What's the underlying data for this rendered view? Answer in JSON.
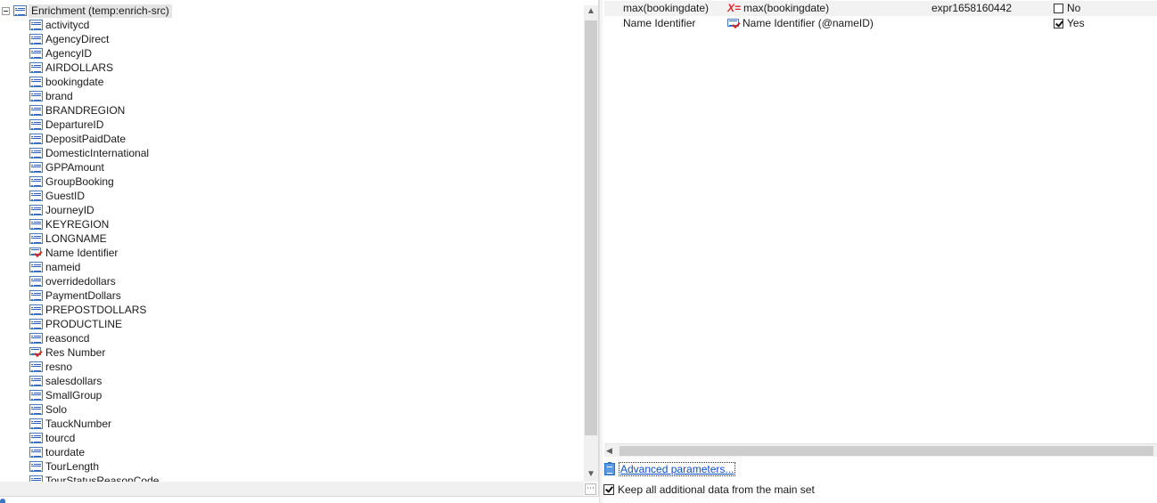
{
  "tree": {
    "root_label": "Enrichment (temp:enrich-src)",
    "items": [
      {
        "label": "activitycd",
        "icon": "field-icon"
      },
      {
        "label": "AgencyDirect",
        "icon": "field-icon"
      },
      {
        "label": "AgencyID",
        "icon": "field-icon"
      },
      {
        "label": "AIRDOLLARS",
        "icon": "field-icon"
      },
      {
        "label": "bookingdate",
        "icon": "field-icon"
      },
      {
        "label": "brand",
        "icon": "field-icon"
      },
      {
        "label": "BRANDREGION",
        "icon": "field-icon"
      },
      {
        "label": "DepartureID",
        "icon": "field-icon"
      },
      {
        "label": "DepositPaidDate",
        "icon": "field-icon"
      },
      {
        "label": "DomesticInternational",
        "icon": "field-icon"
      },
      {
        "label": "GPPAmount",
        "icon": "field-icon"
      },
      {
        "label": "GroupBooking",
        "icon": "field-icon"
      },
      {
        "label": "GuestID",
        "icon": "field-icon"
      },
      {
        "label": "JourneyID",
        "icon": "field-icon"
      },
      {
        "label": "KEYREGION",
        "icon": "field-icon"
      },
      {
        "label": "LONGNAME",
        "icon": "field-icon"
      },
      {
        "label": "Name Identifier",
        "icon": "key-field-icon"
      },
      {
        "label": "nameid",
        "icon": "field-icon"
      },
      {
        "label": "overridedollars",
        "icon": "field-icon"
      },
      {
        "label": "PaymentDollars",
        "icon": "field-icon"
      },
      {
        "label": "PREPOSTDOLLARS",
        "icon": "field-icon"
      },
      {
        "label": "PRODUCTLINE",
        "icon": "field-icon"
      },
      {
        "label": "reasoncd",
        "icon": "field-icon"
      },
      {
        "label": "Res Number",
        "icon": "key-field-icon"
      },
      {
        "label": "resno",
        "icon": "field-icon"
      },
      {
        "label": "salesdollars",
        "icon": "field-icon"
      },
      {
        "label": "SmallGroup",
        "icon": "field-icon"
      },
      {
        "label": "Solo",
        "icon": "field-icon"
      },
      {
        "label": "TauckNumber",
        "icon": "field-icon"
      },
      {
        "label": "tourcd",
        "icon": "field-icon"
      },
      {
        "label": "tourdate",
        "icon": "field-icon"
      },
      {
        "label": "TourLength",
        "icon": "field-icon"
      },
      {
        "label": "TourStatusReasonCode",
        "icon": "field-icon"
      }
    ]
  },
  "grid": {
    "rows": [
      {
        "name": "max(bookingdate)",
        "source_icon": "expression-icon",
        "source_prefix": "X=",
        "source": "max(bookingdate)",
        "alias": "expr1658160442",
        "checked": false,
        "flag": "No"
      },
      {
        "name": "Name Identifier",
        "source_icon": "key-field-icon",
        "source_prefix": "",
        "source": "Name Identifier (@nameID)",
        "alias": "",
        "checked": true,
        "flag": "Yes"
      }
    ]
  },
  "footer": {
    "advanced_label": "Advanced parameters...",
    "keep_label": "Keep all additional data from the main set",
    "keep_checked": true
  },
  "colors": {
    "link": "#0b4dcc",
    "expr": "#e0232b",
    "icon_blue": "#2b62b8"
  }
}
